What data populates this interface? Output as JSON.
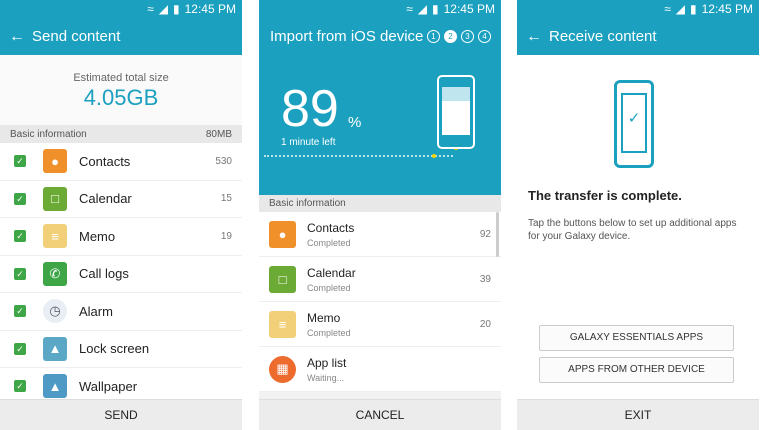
{
  "status_time": "12:45 PM",
  "send": {
    "title": "Send content",
    "estimated_label": "Estimated total size",
    "estimated_value": "4.05GB",
    "section_label": "Basic information",
    "section_size": "80MB",
    "items": [
      {
        "name": "Contacts",
        "count": "530",
        "icon": "contacts-icon",
        "color": "#f0902a"
      },
      {
        "name": "Calendar",
        "count": "15",
        "icon": "calendar-icon",
        "color": "#6aaa35"
      },
      {
        "name": "Memo",
        "count": "19",
        "icon": "memo-icon",
        "color": "#f2d07a"
      },
      {
        "name": "Call logs",
        "count": "",
        "icon": "call-logs-icon",
        "color": "#3ea647"
      },
      {
        "name": "Alarm",
        "count": "",
        "icon": "alarm-icon",
        "color": "#e9eef5"
      },
      {
        "name": "Lock screen",
        "count": "",
        "icon": "lock-screen-icon",
        "color": "#5aa7c6"
      },
      {
        "name": "Wallpaper",
        "count": "",
        "icon": "wallpaper-icon",
        "color": "#4f9ac4"
      }
    ],
    "button": "SEND"
  },
  "import": {
    "title": "Import from iOS device",
    "steps": [
      "1",
      "2",
      "3",
      "4"
    ],
    "active_step": 2,
    "percent": "89",
    "percent_sign": "%",
    "time_left": "1 minute left",
    "progress": 0.89,
    "section_label": "Basic information",
    "items": [
      {
        "name": "Contacts",
        "status": "Completed",
        "count": "92",
        "icon": "contacts-icon",
        "color": "#f0902a"
      },
      {
        "name": "Calendar",
        "status": "Completed",
        "count": "39",
        "icon": "calendar-icon",
        "color": "#6aaa35"
      },
      {
        "name": "Memo",
        "status": "Completed",
        "count": "20",
        "icon": "memo-icon",
        "color": "#f2d07a"
      },
      {
        "name": "App list",
        "status": "Waiting...",
        "count": "",
        "icon": "app-list-icon",
        "color": "#ec6b2d"
      }
    ],
    "button": "CANCEL"
  },
  "receive": {
    "title": "Receive content",
    "heading": "The transfer is complete.",
    "description": "Tap the buttons below to set up additional apps for your Galaxy device.",
    "btn_essentials": "GALAXY ESSENTIALS APPS",
    "btn_other": "APPS FROM OTHER DEVICE",
    "button": "EXIT"
  },
  "colors": {
    "accent": "#1ba0bf",
    "check": "#3ea647"
  }
}
